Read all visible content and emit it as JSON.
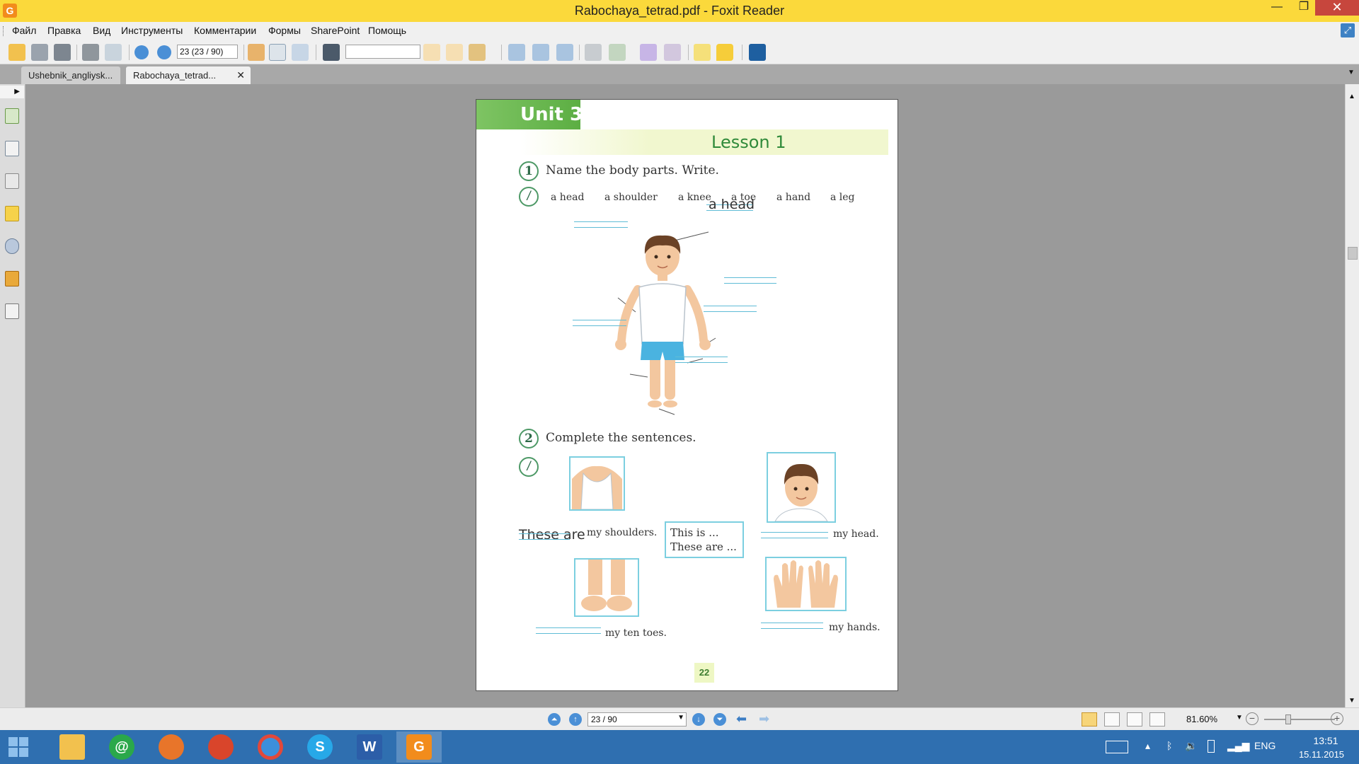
{
  "window": {
    "title": "Rabochaya_tetrad.pdf - Foxit Reader",
    "app_icon": "foxit-logo",
    "minimize": "—",
    "maximize": "❐",
    "close": "✕"
  },
  "menu": {
    "items": [
      "Файл",
      "Правка",
      "Вид",
      "Инструменты",
      "Комментарии",
      "Формы",
      "SharePoint",
      "Помощь"
    ]
  },
  "toolbar": {
    "page_field": "23 (23 / 90)",
    "search_value": ""
  },
  "tabs": [
    {
      "label": "Ushebnik_angliysk...",
      "active": false
    },
    {
      "label": "Rabochaya_tetrad...",
      "active": true
    }
  ],
  "document": {
    "unit": "Unit 3",
    "lesson": "Lesson 1",
    "task1": {
      "number": "1",
      "instruction": "Name the body parts.  Write.",
      "icon": "pencil",
      "words": [
        "a head",
        "a shoulder",
        "a knee",
        "a toe",
        "a hand",
        "a leg"
      ],
      "handwritten": "a head"
    },
    "task2": {
      "number": "2",
      "instruction": "Complete the sentences.",
      "icon": "pencil",
      "handwritten": "These are",
      "captions": [
        "my shoulders.",
        "my head.",
        "my ten toes.",
        "my hands."
      ],
      "hint_line1": "This is ...",
      "hint_line2": "These are ..."
    },
    "page_number": "22"
  },
  "statusbar": {
    "page_field": "23 / 90",
    "zoom": "81.60%"
  },
  "taskbar": {
    "time": "13:51",
    "date": "15.11.2015",
    "language": "ENG",
    "apps": [
      "mail-agent",
      "firefox",
      "firefox-beta",
      "chrome",
      "skype",
      "word",
      "foxit-reader"
    ]
  },
  "colors": {
    "titlebar": "#fbd93b",
    "unit_green": "#5cae43",
    "lesson_green": "#2f8a3a",
    "answer_line": "#5fbcd6",
    "taskbar": "#2f6fb0"
  }
}
